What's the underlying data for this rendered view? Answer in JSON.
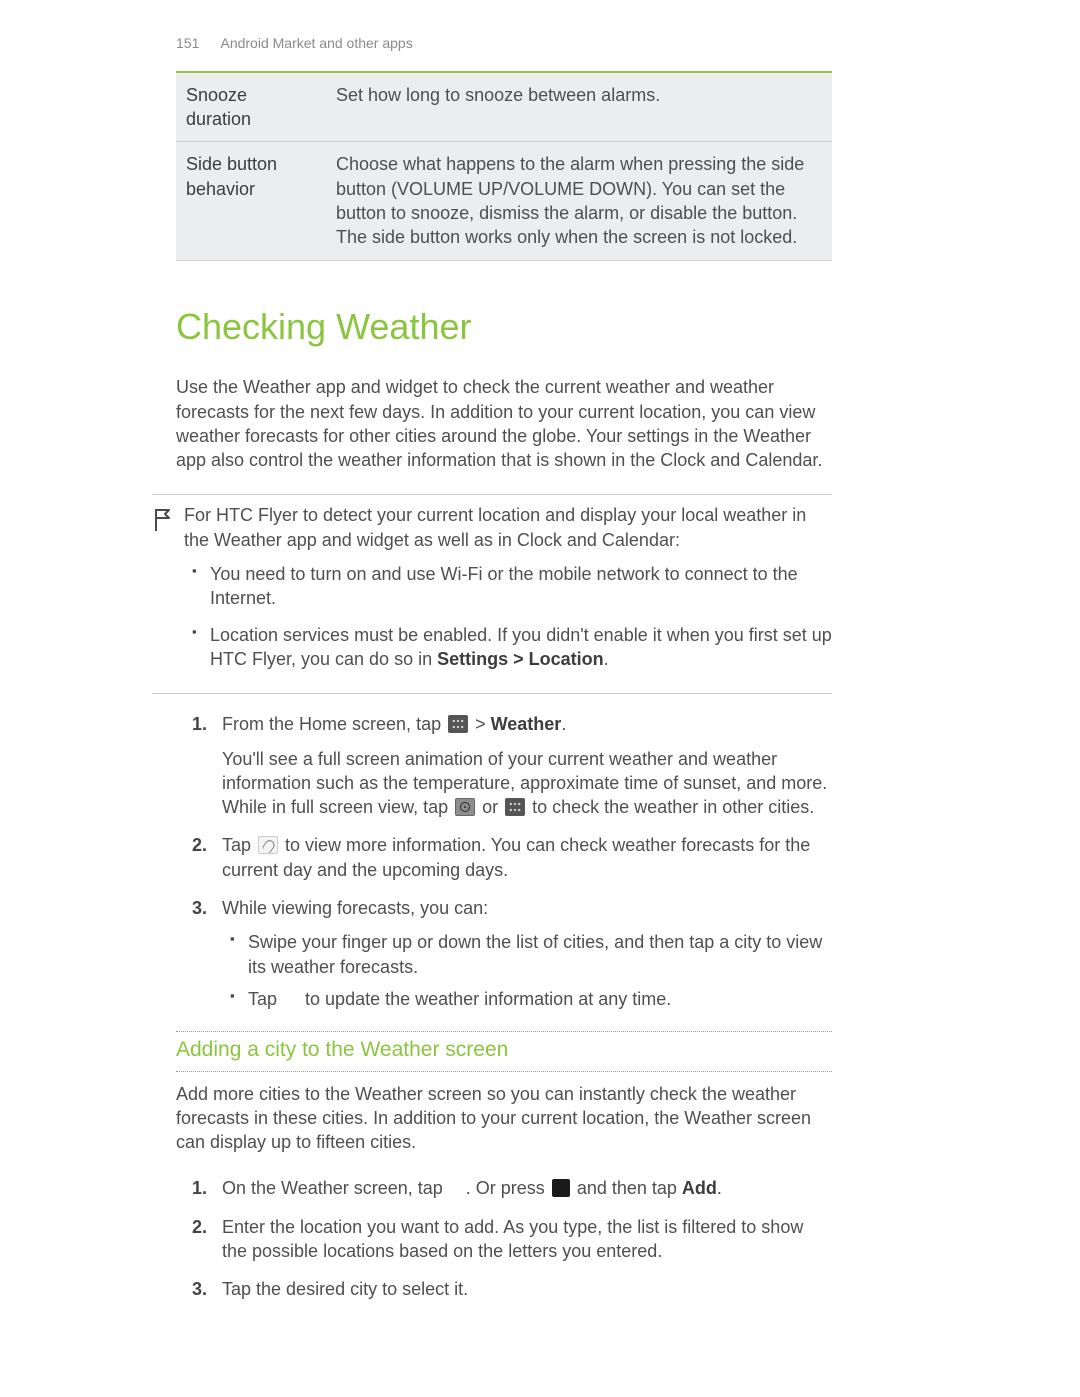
{
  "header": {
    "page_number": "151",
    "section_title": "Android Market and other apps"
  },
  "settings_table": {
    "rows": [
      {
        "term": "Snooze duration",
        "desc": "Set how long to snooze between alarms."
      },
      {
        "term": "Side button behavior",
        "desc": "Choose what happens to the alarm when pressing the side button (VOLUME UP/VOLUME DOWN). You can set the button to snooze, dismiss the alarm, or disable the button. The side button works only when the screen is not locked."
      }
    ]
  },
  "section": {
    "title": "Checking Weather",
    "intro": "Use the Weather app and widget to check the current weather and weather forecasts for the next few days. In addition to your current location, you can view weather forecasts for other cities around the globe. Your settings in the Weather app also control the weather information that is shown in the Clock and Calendar."
  },
  "infobox": {
    "lead": "For HTC Flyer to detect your current location and display your local weather in the Weather app and widget as well as in Clock and Calendar:",
    "bullets": {
      "b1": "You need to turn on and use Wi-Fi or the mobile network to connect to the Internet.",
      "b2_a": "Location services must be enabled. If you didn't enable it when you first set up HTC Flyer, you can do so in ",
      "b2_bold": "Settings > Location",
      "b2_c": "."
    }
  },
  "steps1": {
    "s1_a": "From the Home screen, tap ",
    "s1_mid": " > ",
    "s1_bold": "Weather",
    "s1_end": ".",
    "s1_p_a": "You'll see a full screen animation of your current weather and weather information such as the temperature, approximate time of sunset, and more. While in full screen view, tap ",
    "s1_p_or": " or ",
    "s1_p_end": " to check the weather in other cities.",
    "s2_a": "Tap ",
    "s2_b": " to view more information. You can check weather forecasts for the current day and the upcoming days.",
    "s3": "While viewing forecasts, you can:",
    "s3_bullets": {
      "b1": "Swipe your finger up or down the list of cities, and then tap a city to view its weather forecasts.",
      "b2_a": "Tap ",
      "b2_b": " to update the weather information at any time."
    }
  },
  "subsection": {
    "title": "Adding a city to the Weather screen",
    "intro": "Add more cities to the Weather screen so you can instantly check the weather forecasts in these cities. In addition to your current location, the Weather screen can display up to fifteen cities."
  },
  "steps2": {
    "s1_a": "On the Weather screen, tap ",
    "s1_b": ". Or press ",
    "s1_c": " and then tap ",
    "s1_bold": "Add",
    "s1_d": ".",
    "s2": "Enter the location you want to add. As you type, the list is filtered to show the possible locations based on the letters you entered.",
    "s3": "Tap the desired city to select it."
  }
}
